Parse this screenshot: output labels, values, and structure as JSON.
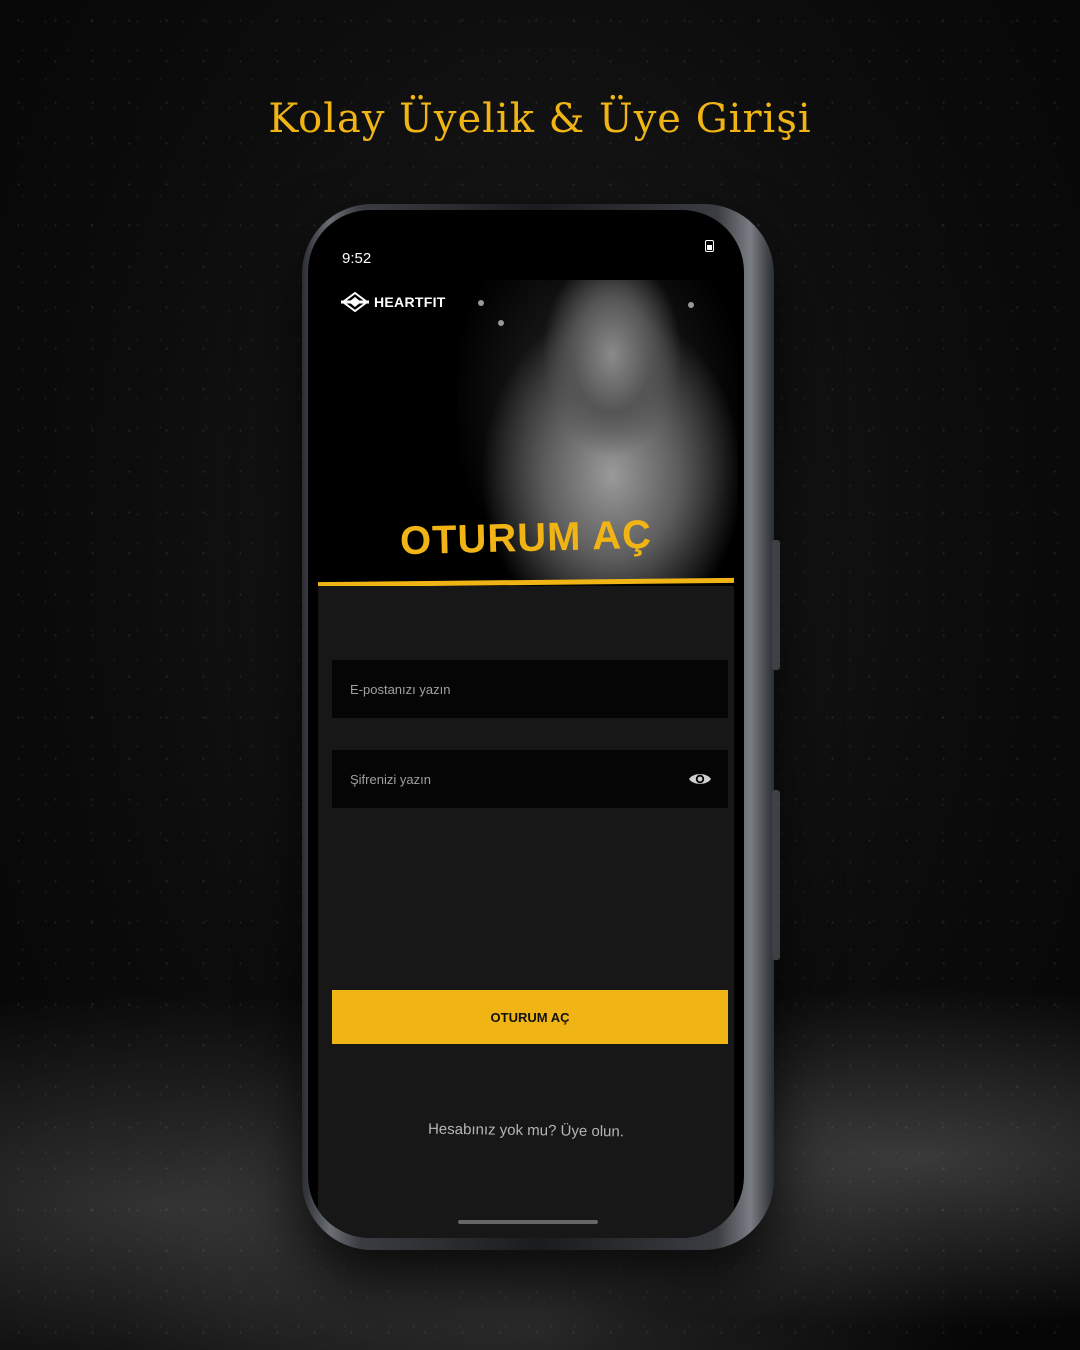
{
  "headline": "Kolay Üyelik & Üye Girişi",
  "status_bar": {
    "time": "9:52",
    "battery_icon": "battery-icon"
  },
  "app": {
    "brand_name": "HEARTFIT",
    "brand_logo_icon": "heartfit-logo-icon",
    "hero_title": "OTURUM AÇ",
    "email_placeholder": "E-postanızı yazın",
    "password_placeholder": "Şifrenizi yazın",
    "password_toggle_icon": "eye-icon",
    "login_button_label": "OTURUM AÇ",
    "signup_link": "Hesabınız yok mu? Üye olun."
  },
  "colors": {
    "accent": "#f0b414",
    "background": "#0c0c0c",
    "panel": "#171717",
    "field": "#050505"
  }
}
